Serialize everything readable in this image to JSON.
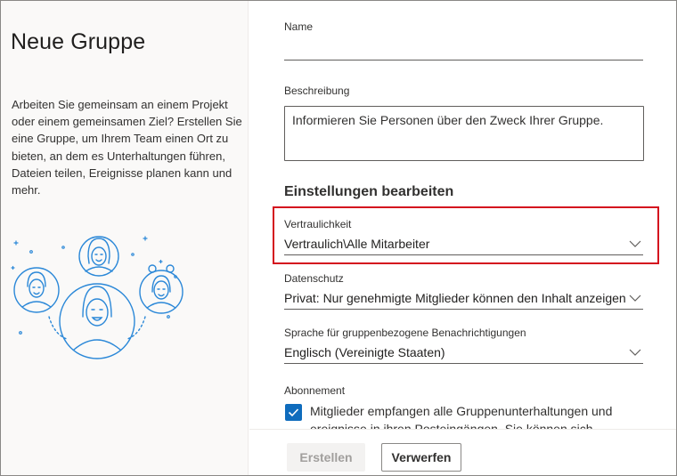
{
  "left": {
    "title": "Neue Gruppe",
    "description": "Arbeiten Sie gemeinsam an einem Projekt oder einem gemeinsamen Ziel? Erstellen Sie eine Gruppe, um Ihrem Team einen Ort zu bieten, an dem es Unterhaltungen führen, Dateien teilen, Ereignisse planen kann und mehr."
  },
  "form": {
    "name_label": "Name",
    "name_value": "",
    "description_label": "Beschreibung",
    "description_placeholder": "Informieren Sie Personen über den Zweck Ihrer Gruppe.",
    "settings_heading": "Einstellungen bearbeiten",
    "confidentiality_label": "Vertraulichkeit",
    "confidentiality_value": "Vertraulich\\Alle Mitarbeiter",
    "privacy_label": "Datenschutz",
    "privacy_value": "Privat: Nur genehmigte Mitglieder können den Inhalt anzeigen",
    "language_label": "Sprache für gruppenbezogene Benachrichtigungen",
    "language_value": "Englisch (Vereinigte Staaten)",
    "subscription_label": "Abonnement",
    "subscription_checked": true,
    "subscription_text": "Mitglieder empfangen alle Gruppenunterhaltungen und ereignisse in ihren Posteingängen. Sie können sich später"
  },
  "footer": {
    "create_label": "Erstellen",
    "discard_label": "Verwerfen"
  },
  "colors": {
    "accent": "#0f6cbd",
    "highlight": "#d40f1e",
    "illustration": "#2b88d8"
  },
  "icons": {
    "dropdown": "chevron-down-icon",
    "checkbox": "checkmark-icon",
    "illustration": "people-group-icon"
  }
}
